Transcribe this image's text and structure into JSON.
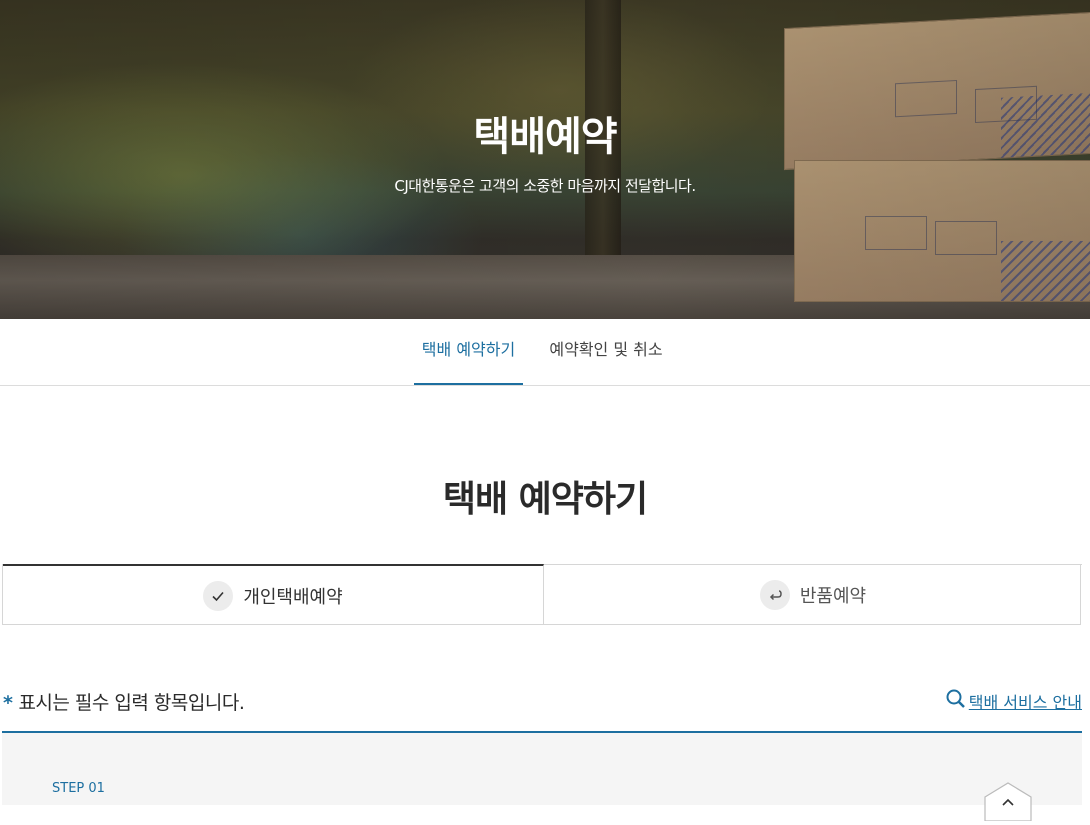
{
  "hero": {
    "title": "택배예약",
    "subtitle": "CJ대한통운은 고객의 소중한 마음까지 전달합니다."
  },
  "tabs": [
    {
      "label": "택배 예약하기",
      "active": true
    },
    {
      "label": "예약확인 및 취소",
      "active": false
    }
  ],
  "section_title": "택배 예약하기",
  "reservation_types": [
    {
      "label": "개인택배예약",
      "icon": "check-icon",
      "active": true
    },
    {
      "label": "반품예약",
      "icon": "return-arrow-icon",
      "active": false
    }
  ],
  "required_note": {
    "star": "*",
    "text": "표시는 필수 입력 항목입니다."
  },
  "service_link": {
    "label": "택배 서비스 안내",
    "icon": "search-icon"
  },
  "step": {
    "label": "STEP 01",
    "toggle_icon": "chevron-up-icon"
  },
  "colors": {
    "accent": "#1d6fa0",
    "text_dark": "#2a2a2a",
    "panel_bg": "#f5f5f5"
  }
}
